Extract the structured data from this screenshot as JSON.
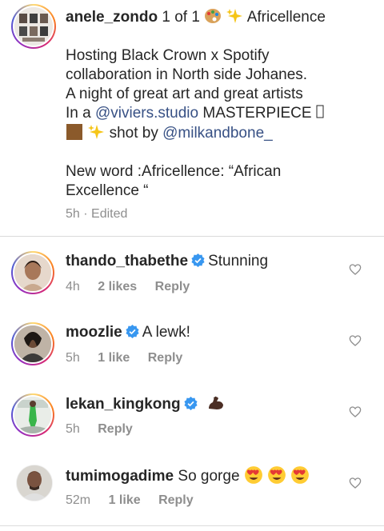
{
  "caption": {
    "username": "anele_zondo",
    "counter": "1 of 1",
    "tag_text": "Africellence",
    "line1": "Hosting Black Crown x Spotify",
    "line2": "collaboration in North side Johanes.",
    "line3": "A night of great art and great artists",
    "line4_prefix": "In a",
    "mention1": "@viviers.studio",
    "line4_suffix": "MASTERPIECE",
    "line5_mid": "shot by",
    "mention2": "@milkandbone_",
    "line6": "New word :Africellence: “African",
    "line7": "Excellence “",
    "time": "5h",
    "edited": "· Edited"
  },
  "comments": [
    {
      "username": "thando_thabethe",
      "verified": true,
      "text": "Stunning",
      "time": "4h",
      "likes": "2 likes",
      "reply": "Reply"
    },
    {
      "username": "moozlie",
      "verified": true,
      "text": "A lewk!",
      "time": "5h",
      "likes": "1 like",
      "reply": "Reply"
    },
    {
      "username": "lekan_kingkong",
      "verified": true,
      "text": "",
      "time": "5h",
      "likes": "",
      "reply": "Reply",
      "emoji": "flexed-biceps-dark"
    },
    {
      "username": "tumimogadime",
      "verified": false,
      "text": "So gorge",
      "time": "52m",
      "likes": "1 like",
      "reply": "Reply",
      "emoji": "heart-eyes x3"
    }
  ],
  "colors": {
    "link": "#385185",
    "verified": "#3897f0",
    "meta": "#8e8e8e",
    "divider": "#dbdbdb"
  }
}
